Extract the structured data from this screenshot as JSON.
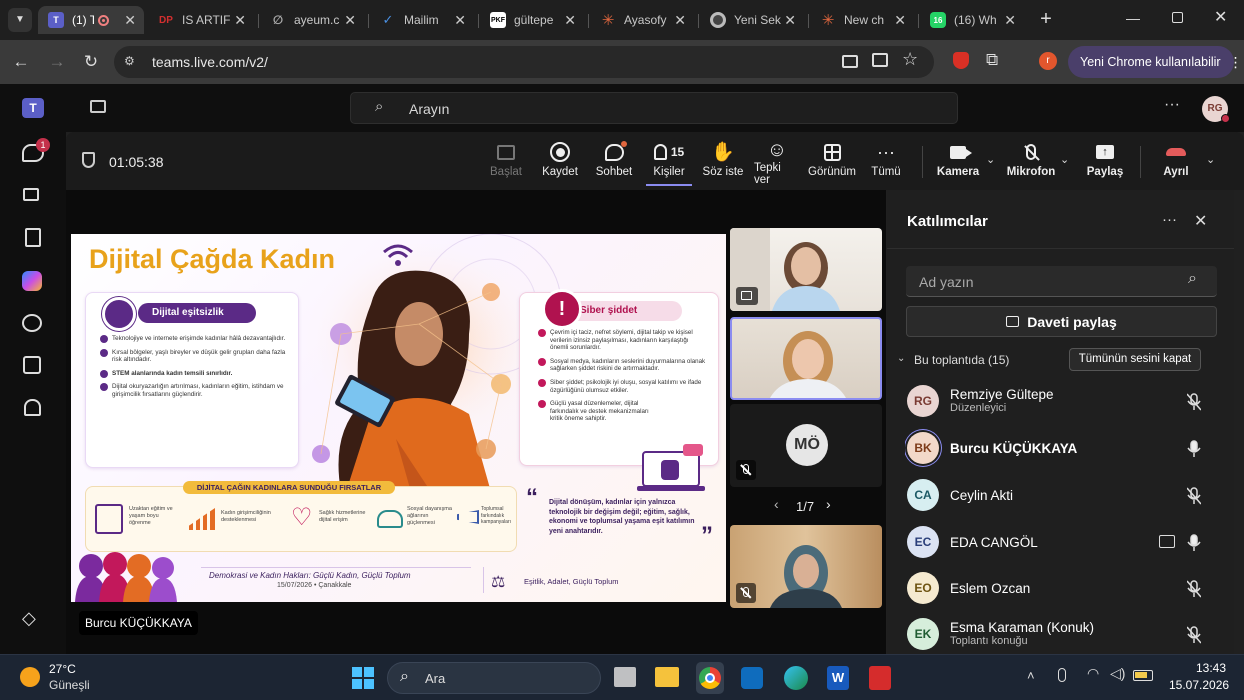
{
  "browser": {
    "tabs": [
      {
        "title": "(1) T",
        "favicon": "teams-icon",
        "active": true
      },
      {
        "title": "IS ARTIF",
        "favicon": "dp-icon"
      },
      {
        "title": "ayeum.c",
        "favicon": "link-icon"
      },
      {
        "title": "Mailim",
        "favicon": "mail-icon"
      },
      {
        "title": "gültepe",
        "favicon": "pkf-icon"
      },
      {
        "title": "Ayasofy",
        "favicon": "asterisk-icon"
      },
      {
        "title": "Yeni Sek",
        "favicon": "chrome-icon"
      },
      {
        "title": "New ch",
        "favicon": "asterisk-icon"
      },
      {
        "title": "(16) Wh",
        "favicon": "whatsapp-icon"
      }
    ],
    "url": "teams.live.com/v2/",
    "profile_initial": "r",
    "new_chrome_label": "Yeni Chrome kullanılabilir"
  },
  "teams": {
    "search_placeholder": "Arayın",
    "user_initials": "RG",
    "chat_badge": "1",
    "meeting": {
      "timer": "01:05:38",
      "toolbar": {
        "start": "Başlat",
        "record": "Kaydet",
        "chat": "Sohbet",
        "people": "Kişiler",
        "people_count": "15",
        "raise_hand": "Söz iste",
        "react": "Tepki ver",
        "view": "Görünüm",
        "more": "Tümü",
        "camera": "Kamera",
        "mic": "Mikrofon",
        "share": "Paylaş",
        "leave": "Ayrıl"
      },
      "presenter_name": "Burcu KÜÇÜKKAYA",
      "gallery_page": "1/7",
      "tile_initials": "MÖ"
    },
    "participants": {
      "title": "Katılımcılar",
      "search_placeholder": "Ad yazın",
      "share_invite": "Daveti paylaş",
      "section_label": "Bu toplantıda (15)",
      "mute_all": "Tümünün sesini kapat",
      "list": [
        {
          "initials": "RG",
          "name": "Remziye Gültepe",
          "role": "Düzenleyici",
          "color": "#e9d5d2",
          "fg": "#7a3b33",
          "mic": "off"
        },
        {
          "initials": "BK",
          "name": "Burcu KÜÇÜKKAYA",
          "role": "",
          "color": "#f2d8c9",
          "fg": "#7d3b1a",
          "mic": "on"
        },
        {
          "initials": "CA",
          "name": "Ceylin Akti",
          "role": "",
          "color": "#d7eef1",
          "fg": "#1c5a66",
          "mic": "off"
        },
        {
          "initials": "EC",
          "name": "EDA CANGÖL",
          "role": "",
          "color": "#dbe3f3",
          "fg": "#2b3f7a",
          "mic": "on"
        },
        {
          "initials": "EO",
          "name": "Eslem Ozcan",
          "role": "",
          "color": "#f5ead0",
          "fg": "#6d5312",
          "mic": "off"
        },
        {
          "initials": "EK",
          "name": "Esma Karaman (Konuk)",
          "role": "Toplantı konuğu",
          "color": "#d6eedb",
          "fg": "#1f5d32",
          "mic": "off"
        }
      ]
    }
  },
  "slide": {
    "title": "Dijital Çağda Kadın",
    "inequality": {
      "heading": "Dijital eşitsizlik",
      "items": [
        "Teknolojiye ve internete erişimde kadınlar hâlâ dezavantajlıdır.",
        "Kırsal bölgeler, yaşlı bireyler ve düşük gelir grupları daha fazla risk altındadır.",
        "STEM alanlarında kadın temsili sınırlıdır.",
        "Dijital okuryazarlığın artırılması, kadınların eğitim, istihdam ve girişimcilik fırsatlarını güçlendirir."
      ]
    },
    "cyber": {
      "heading": "Siber şiddet",
      "items": [
        "Çevrim içi taciz, nefret söylemi, dijital takip ve kişisel verilerin izinsiz paylaşılması, kadınların karşılaştığı önemli sorunlardır.",
        "Sosyal medya, kadınların seslerini duyurmalarına olanak sağlarken şiddet riskini de artırmaktadır.",
        "Siber şiddet; psikolojik iyi oluşu, sosyal katılımı ve ifade özgürlüğünü olumsuz etkiler.",
        "Güçlü yasal düzenlemeler, dijital farkındalık ve destek mekanizmaları kritik öneme sahiptir."
      ]
    },
    "opportunities": {
      "heading": "DİJİTAL ÇAĞIN KADINLARA SUNDUĞU FIRSATLAR",
      "items": [
        "Uzaktan eğitim ve yaşam boyu öğrenme",
        "Kadın girişimciliğinin desteklenmesi",
        "Sağlık hizmetlerine dijital erişim",
        "Sosyal dayanışma ağlarının güçlenmesi",
        "Toplumsal farkındalık kampanyaları"
      ]
    },
    "quote": "Dijital dönüşüm, kadınlar için yalnızca teknolojik bir değişim değil; eğitim, sağlık, ekonomi ve toplumsal yaşama eşit katılımın yeni anahtarıdır.",
    "footer_title": "Demokrasi ve Kadın Hakları: Güçlü Kadın, Güçlü Toplum",
    "footer_date": "15/07/2026 • Çanakkale",
    "footer_right": "Eşitlik, Adalet, Güçlü Toplum"
  },
  "taskbar": {
    "temperature": "27°C",
    "weather": "Güneşli",
    "search": "Ara",
    "time": "13:43",
    "date": "15.07.2026"
  }
}
